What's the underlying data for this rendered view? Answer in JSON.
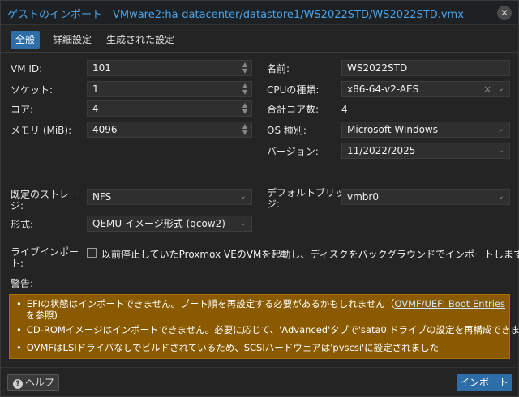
{
  "window": {
    "title": "ゲストのインポート - VMware2:ha-datacenter/datastore1/WS2022STD/WS2022STD.vmx",
    "close_glyph": "✕"
  },
  "tabs": [
    {
      "label": "全般"
    },
    {
      "label": "詳細設定"
    },
    {
      "label": "生成された設定"
    }
  ],
  "left": {
    "vmid_label": "VM ID:",
    "vmid_value": "101",
    "sockets_label": "ソケット:",
    "sockets_value": "1",
    "cores_label": "コア:",
    "cores_value": "4",
    "memory_label": "メモリ (MiB):",
    "memory_value": "4096"
  },
  "right": {
    "name_label": "名前:",
    "name_value": "WS2022STD",
    "cpu_label": "CPUの種類:",
    "cpu_value": "x86-64-v2-AES",
    "total_cores_label": "合計コア数:",
    "total_cores_value": "4",
    "os_label": "OS 種別:",
    "os_value": "Microsoft Windows",
    "version_label": "バージョン:",
    "version_value": "11/2022/2025"
  },
  "storage": {
    "storage_label_1": "既定のストレー",
    "storage_label_2": "ジ:",
    "storage_value": "NFS",
    "format_label": "形式:",
    "format_value": "QEMU イメージ形式 (qcow2)",
    "bridge_label_1": "デフォルトブリッ",
    "bridge_label_2": "ジ:",
    "bridge_value": "vmbr0"
  },
  "live": {
    "label_1": "ライブインポー",
    "label_2": "ト:",
    "checkbox_text": "以前停止していたProxmox VEのVMを起動し、ディスクをバックグラウンドでインポートします"
  },
  "warnings": {
    "label": "警告:",
    "w1_text": "EFIの状態はインポートできません。ブート順を再設定する必要があるかもしれません（",
    "w1_link": "OVMF/UEFI Boot Entries",
    "w1_cont": "を参照)",
    "w2": "CD-ROMイメージはインポートできません。必要に応じて、'Advanced'タブで'sata0'ドライブの設定を再構成できます。",
    "w3": "OVMFはLSIドライバなしでビルドされているため、SCSIハードウェアは'pvscsi'に設定されました",
    "bullet": "•"
  },
  "footer": {
    "help_icon": "?",
    "help_label": "ヘルプ",
    "import_label": "インポート"
  }
}
